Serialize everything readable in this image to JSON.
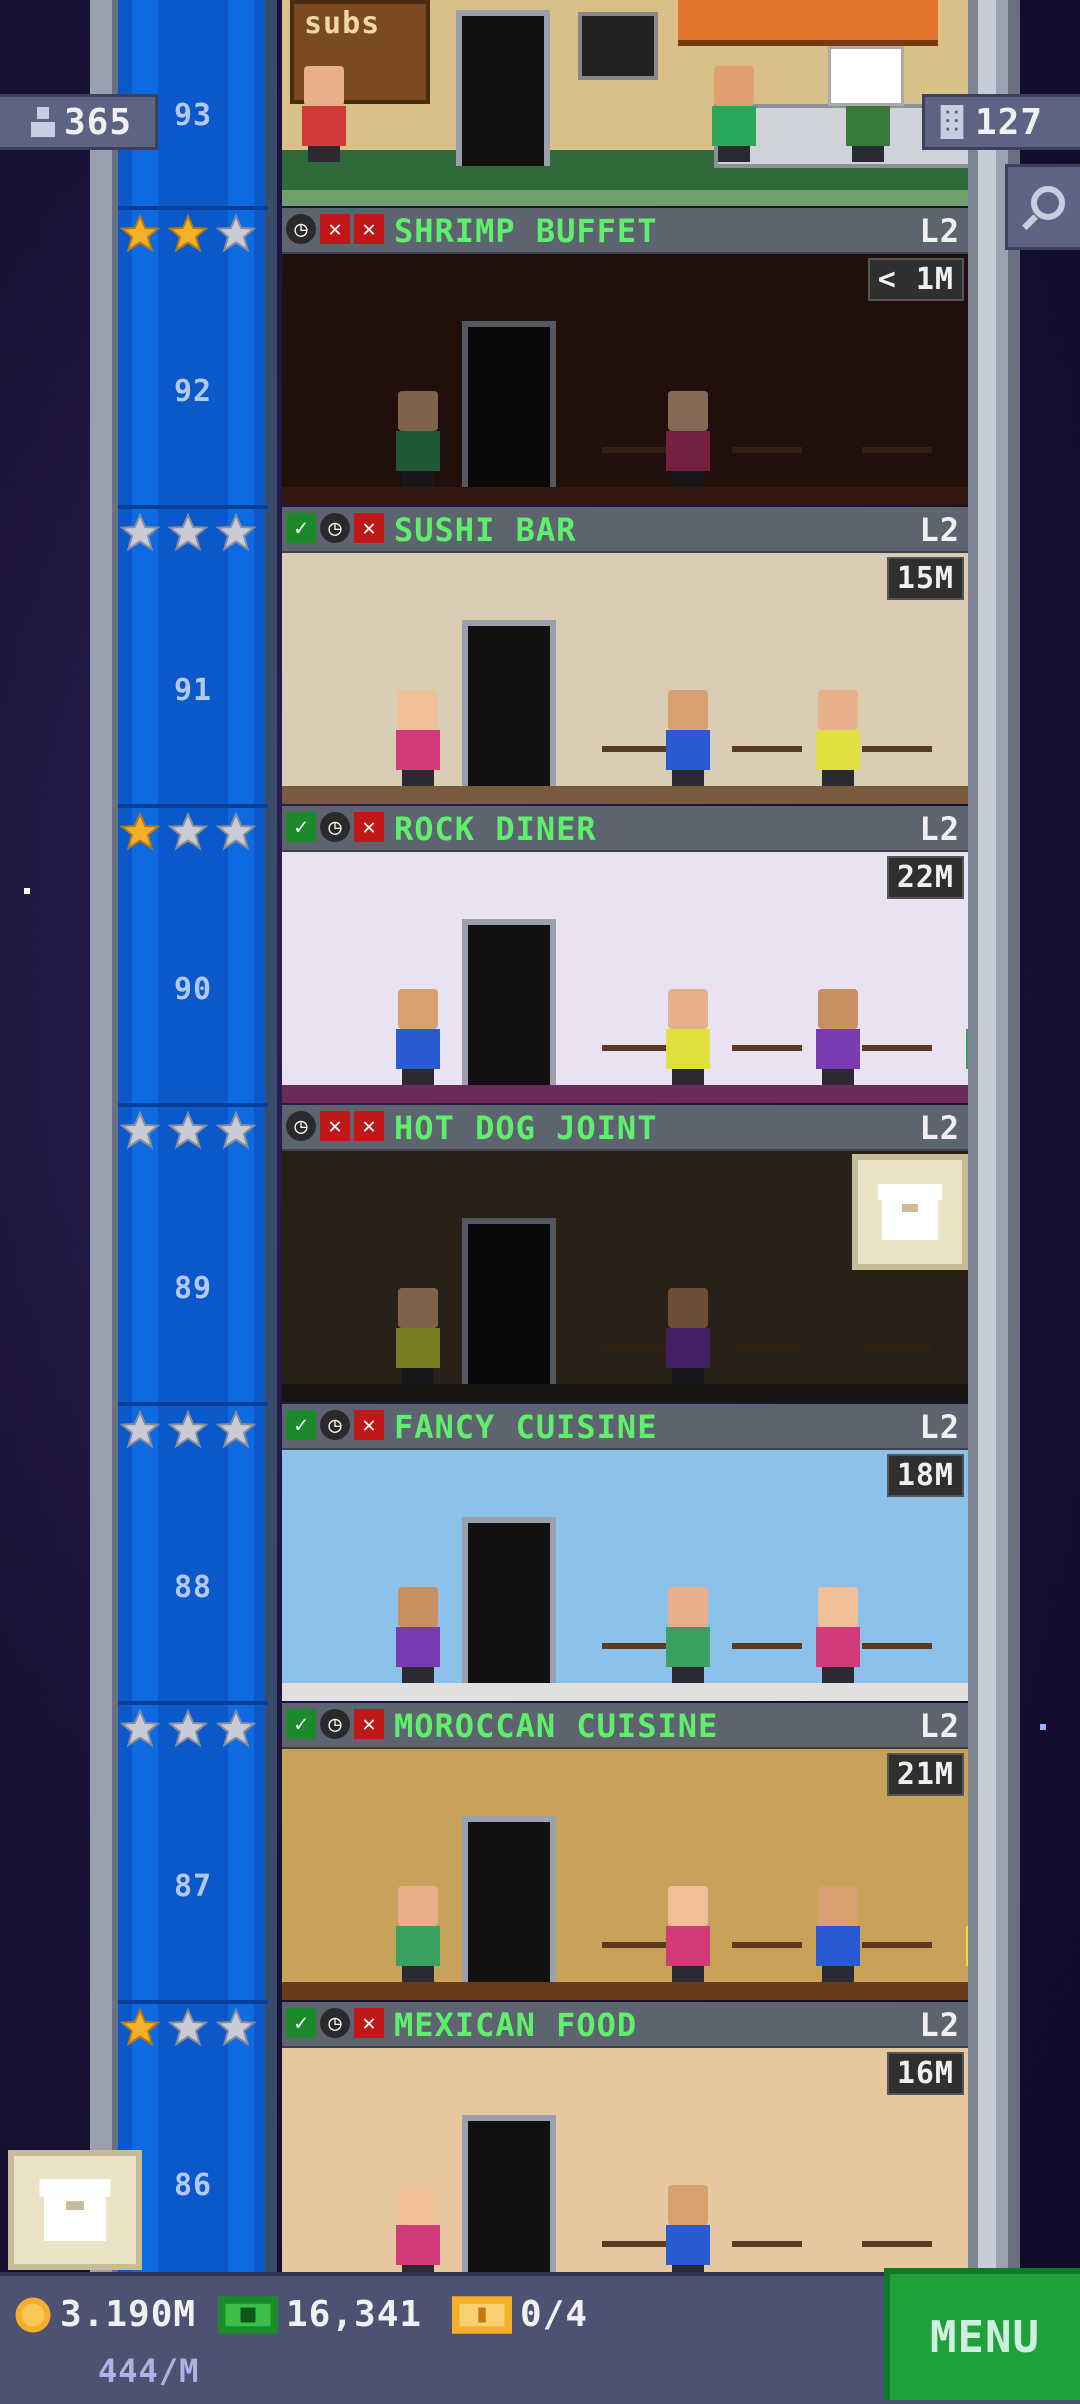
{
  "hud": {
    "population": "365",
    "floors": "127",
    "coins": "3.190M",
    "bux": "16,341",
    "tickets": "0/4",
    "rate": "444/M",
    "menu_label": "MENU"
  },
  "top_floor": {
    "number": "93",
    "sign_text": "SUBS"
  },
  "floors": [
    {
      "number": "92",
      "name": "SHRIMP BUFFET",
      "level": "L2",
      "price": "< 1M",
      "stars_gold": 2,
      "checked": false,
      "dark": true,
      "wall": "#3a1c14",
      "floor_col": "#5a2a1c"
    },
    {
      "number": "91",
      "name": "SUSHI BAR",
      "level": "L2",
      "price": "15M",
      "stars_gold": 0,
      "checked": true,
      "dark": false,
      "wall": "#d9cdb4",
      "floor_col": "#7a5a3c"
    },
    {
      "number": "90",
      "name": "ROCK DINER",
      "level": "L2",
      "price": "22M",
      "stars_gold": 1,
      "checked": true,
      "dark": false,
      "wall": "#e9e2f2",
      "floor_col": "#6a2a5a"
    },
    {
      "number": "89",
      "name": "HOT DOG JOINT",
      "level": "L2",
      "price": "",
      "stars_gold": 0,
      "checked": false,
      "dark": true,
      "wall": "#4a3a2a",
      "floor_col": "#2a2420"
    },
    {
      "number": "88",
      "name": "FANCY CUISINE",
      "level": "L2",
      "price": "18M",
      "stars_gold": 0,
      "checked": true,
      "dark": false,
      "wall": "#8cc2ea",
      "floor_col": "#e0e0e0"
    },
    {
      "number": "87",
      "name": "MOROCCAN CUISINE",
      "level": "L2",
      "price": "21M",
      "stars_gold": 0,
      "checked": true,
      "dark": false,
      "wall": "#c9a25a",
      "floor_col": "#6a3a1c"
    },
    {
      "number": "86",
      "name": "MEXICAN FOOD",
      "level": "L2",
      "price": "16M",
      "stars_gold": 1,
      "checked": true,
      "dark": false,
      "wall": "#e7c7a0",
      "floor_col": "#8a5a3a"
    }
  ],
  "colors": {
    "shaft_blue": "#0e6ae0",
    "banner_name": "#5ef06a",
    "menu_green": "#1ea03a",
    "star_gold": "#f5b02a",
    "star_silver": "#c9ccd6"
  }
}
